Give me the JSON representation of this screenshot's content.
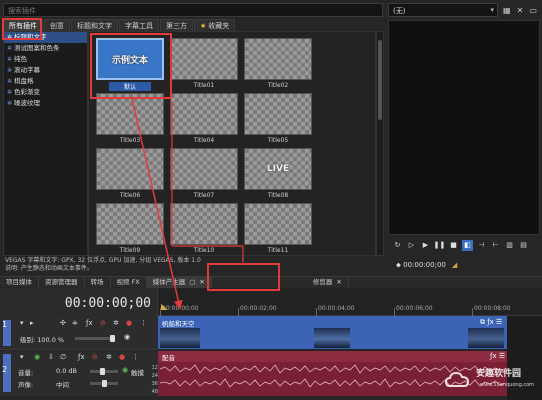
{
  "browser": {
    "search_placeholder": "搜索插件",
    "tabs": [
      {
        "label": "所有插件",
        "active": true
      },
      {
        "label": "创意",
        "active": false
      },
      {
        "label": "标题和文字",
        "active": false
      },
      {
        "label": "字幕工具",
        "active": false
      },
      {
        "label": "第三方",
        "active": false
      },
      {
        "label": "收藏夹",
        "active": false,
        "icon": "star-icon"
      }
    ],
    "tree": [
      {
        "label": "标题和文字",
        "selected": true
      },
      {
        "label": "测试图案和色条",
        "selected": false
      },
      {
        "label": "纯色",
        "selected": false
      },
      {
        "label": "滚动字幕",
        "selected": false
      },
      {
        "label": "棋盘格",
        "selected": false
      },
      {
        "label": "色彩渐变",
        "selected": false
      },
      {
        "label": "噪波纹理",
        "selected": false
      }
    ],
    "presets": [
      {
        "label": "默认",
        "thumb_text": "示例文本",
        "selected": true
      },
      {
        "label": "Title01",
        "thumb_text": ""
      },
      {
        "label": "Title02",
        "thumb_text": ""
      },
      {
        "label": "Title03",
        "thumb_text": ""
      },
      {
        "label": "Title04",
        "thumb_text": ""
      },
      {
        "label": "Title05",
        "thumb_text": ""
      },
      {
        "label": "Title06",
        "thumb_text": ""
      },
      {
        "label": "Title07",
        "thumb_text": ""
      },
      {
        "label": "Title08",
        "thumb_text": "LIVE"
      },
      {
        "label": "Title09",
        "thumb_text": ""
      },
      {
        "label": "Title10",
        "thumb_text": ""
      },
      {
        "label": "Title11",
        "thumb_text": ""
      }
    ],
    "description_line1": "VEGAS 字幕和文字: GPX, 32 位浮点, GPU 加速, 分组 VEGAS, 版本 1.0",
    "description_line2": "说明: 产生静态和动画文本事件。"
  },
  "bottom_tabs": [
    {
      "label": "项目媒体"
    },
    {
      "label": "资源管理器"
    },
    {
      "label": "转场"
    },
    {
      "label": "视频 FX"
    },
    {
      "label": "媒体产生器",
      "active": true
    },
    {
      "label": "修剪器"
    }
  ],
  "preview": {
    "select_value": "(无)",
    "timecode": "00:00:00;00"
  },
  "timeline": {
    "timecode": "00:00:00;00",
    "ruler": [
      "00:00:00;00",
      "00:00:02;00",
      "00:00:04;00",
      "00:00:06;00",
      "00:00:08;00"
    ],
    "video_track": {
      "number": "1",
      "level_label": "级别: 100.0 %",
      "clip_title": "帆船和天空"
    },
    "audio_track": {
      "number": "2",
      "volume_label": "音量:",
      "volume_value": "0.0 dB",
      "pan_label": "声像:",
      "pan_value": "中间",
      "mode_label": "触摸",
      "clip_title": "配音",
      "db_scale": [
        "12",
        "24",
        "36",
        "48",
        "54"
      ]
    }
  },
  "watermark": {
    "text": "安趣软件园",
    "url": "www.52anquong.com"
  },
  "colors": {
    "accent_blue": "#3a6fc0",
    "video_track": "#3c63b5",
    "audio_track": "#7a2034",
    "annotation_red": "#e23b3b"
  }
}
